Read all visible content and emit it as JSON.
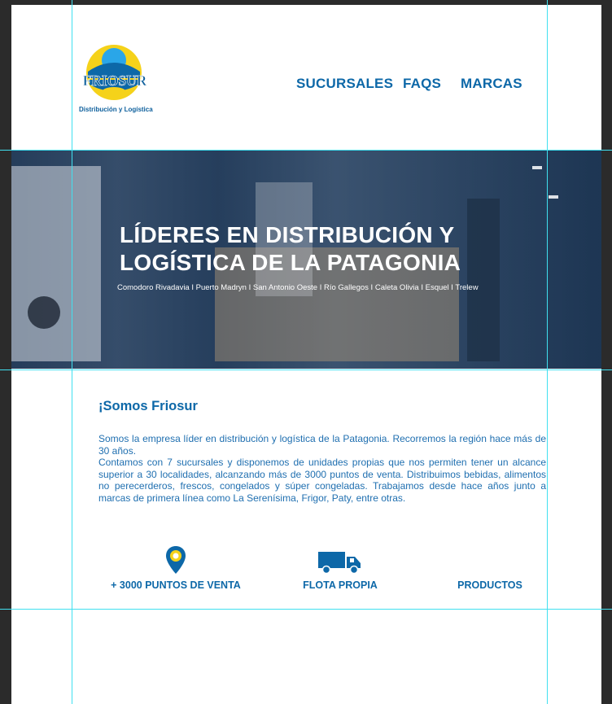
{
  "header": {
    "logo_text": "FRIOSUR",
    "logo_tagline": "Distribución y Logística",
    "nav": [
      {
        "label": "SUCURSALES"
      },
      {
        "label": "FAQS"
      },
      {
        "label": "MARCAS"
      }
    ]
  },
  "hero": {
    "title": "LÍDERES EN DISTRIBUCIÓN Y\nLOGÍSTICA DE LA PATAGONIA",
    "subtitle": "Comodoro Rivadavia I Puerto Madryn I San Antonio Oeste I Río Gallegos I Caleta Olivia I Esquel I Trelew"
  },
  "about": {
    "title": "¡Somos Friosur",
    "paragraphs": [
      "Somos la empresa líder en distribución y logística de la Patagonia. Recorremos la región hace más de 30 años.",
      "Contamos con 7 sucursales y disponemos de unidades propias que nos permiten tener un alcance superior a 30 localidades, alcanzando más de 3000 puntos de venta. Distribuimos bebidas, alimentos no perecerderos, frescos, congelados y súper congeladas. Trabajamos desde hace años junto a marcas de primera línea como La Serenísima, Frigor, Paty, entre otras."
    ]
  },
  "features": [
    {
      "label": "+ 3000 PUNTOS DE VENTA",
      "icon": "map-pin-icon"
    },
    {
      "label": "FLOTA PROPIA",
      "icon": "truck-icon"
    },
    {
      "label": "PRODUCTOS",
      "icon": ""
    }
  ],
  "colors": {
    "brand_blue": "#0d68a8",
    "brand_yellow": "#f5d21a",
    "light_blue": "#2aa6e8",
    "guide_cyan": "#40e0f0"
  }
}
